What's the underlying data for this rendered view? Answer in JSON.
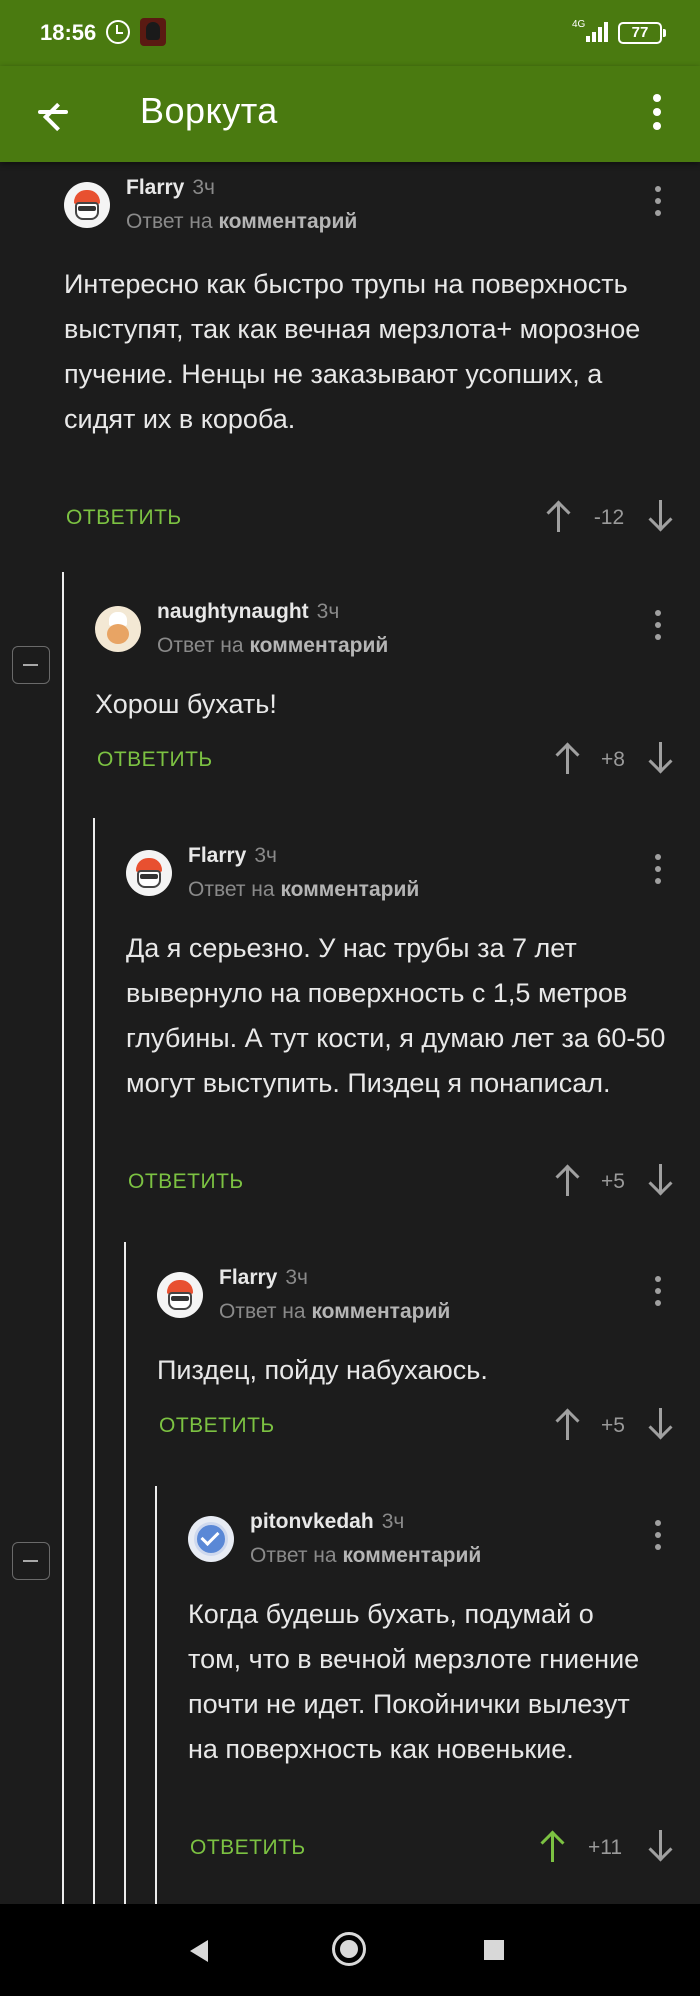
{
  "status_bar": {
    "time": "18:56",
    "network": "4G",
    "battery": "77"
  },
  "app_bar": {
    "title": "Воркута"
  },
  "comments": [
    {
      "username": "Flarry",
      "time": "3ч",
      "reply_prefix": "Ответ на",
      "reply_target": "комментарий",
      "text": "Интересно как быстро трупы на поверхность выступят, так как вечная мерзлота+ морозное пучение. Ненцы не заказывают усопших, а сидят их в короба.",
      "reply_label": "ОТВЕТИТЬ",
      "rating": "-12",
      "avatar": "stormtrooper-avatar",
      "upvoted": false
    },
    {
      "username": "naughtynaught",
      "time": "3ч",
      "reply_prefix": "Ответ на",
      "reply_target": "комментарий",
      "text": "Хорош бухать!",
      "reply_label": "ОТВЕТИТЬ",
      "rating": "+8",
      "avatar": "cook-avatar",
      "upvoted": false
    },
    {
      "username": "Flarry",
      "time": "3ч",
      "reply_prefix": "Ответ на",
      "reply_target": "комментарий",
      "text": "Да я серьезно. У нас трубы за 7 лет вывернуло на поверхность с 1,5 метров глубины. А тут кости, я думаю лет за 60-50 могут выступить. Пиздец я понаписал.",
      "reply_label": "ОТВЕТИТЬ",
      "rating": "+5",
      "avatar": "stormtrooper-avatar",
      "upvoted": false
    },
    {
      "username": "Flarry",
      "time": "3ч",
      "reply_prefix": "Ответ на",
      "reply_target": "комментарий",
      "text": "Пиздец, пойду набухаюсь.",
      "reply_label": "ОТВЕТИТЬ",
      "rating": "+5",
      "avatar": "stormtrooper-avatar",
      "upvoted": false
    },
    {
      "username": "pitonvkedah",
      "time": "3ч",
      "reply_prefix": "Ответ на",
      "reply_target": "комментарий",
      "text": "Когда будешь бухать, подумай о том, что в вечной мерзлоте гниение почти не идет. Покойнички вылезут на поверхность как новенькие.",
      "reply_label": "ОТВЕТИТЬ",
      "rating": "+11",
      "avatar": "verified-avatar",
      "upvoted": true
    }
  ],
  "colors": {
    "brand_green": "#4a7a10",
    "reply_green": "#7cc242",
    "background": "#1c1c1c"
  }
}
